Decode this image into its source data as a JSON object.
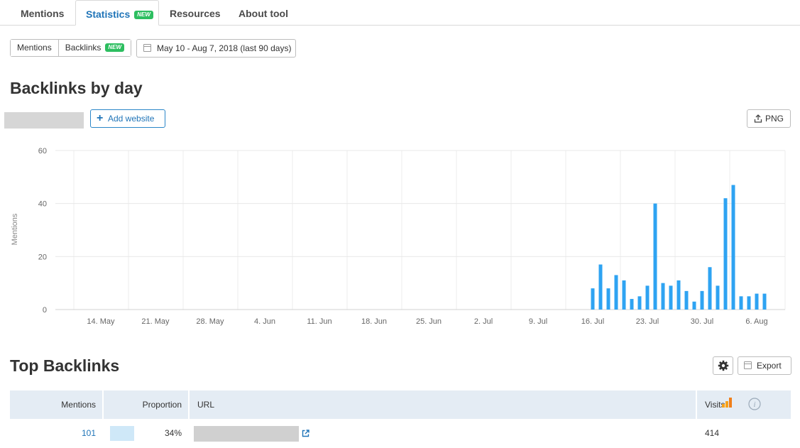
{
  "tabs": [
    {
      "label": "Mentions",
      "active": false
    },
    {
      "label": "Statistics",
      "active": true,
      "badge": "NEW"
    },
    {
      "label": "Resources",
      "active": false
    },
    {
      "label": "About tool",
      "active": false
    }
  ],
  "filters": {
    "segment": [
      {
        "label": "Mentions"
      },
      {
        "label": "Backlinks",
        "badge": "NEW"
      }
    ],
    "date_range": "May 10 - Aug 7, 2018 (last 90 days)"
  },
  "backlinks_section": {
    "title": "Backlinks by day",
    "add_website_label": "Add website",
    "png_label": "PNG"
  },
  "chart_data": {
    "type": "bar",
    "title": "",
    "xlabel": "",
    "ylabel": "Mentions",
    "ylim": [
      0,
      60
    ],
    "yticks": [
      0,
      20,
      40,
      60
    ],
    "grid": true,
    "start_date": "2018-05-10",
    "x_tick_labels": [
      {
        "date": "2018-05-14",
        "label": "14. May"
      },
      {
        "date": "2018-05-21",
        "label": "21. May"
      },
      {
        "date": "2018-05-28",
        "label": "28. May"
      },
      {
        "date": "2018-06-04",
        "label": "4. Jun"
      },
      {
        "date": "2018-06-11",
        "label": "11. Jun"
      },
      {
        "date": "2018-06-18",
        "label": "18. Jun"
      },
      {
        "date": "2018-06-25",
        "label": "25. Jun"
      },
      {
        "date": "2018-07-02",
        "label": "2. Jul"
      },
      {
        "date": "2018-07-09",
        "label": "9. Jul"
      },
      {
        "date": "2018-07-16",
        "label": "16. Jul"
      },
      {
        "date": "2018-07-23",
        "label": "23. Jul"
      },
      {
        "date": "2018-07-30",
        "label": "30. Jul"
      },
      {
        "date": "2018-08-06",
        "label": "6. Aug"
      }
    ],
    "bars": [
      {
        "date": "2018-07-16",
        "value": 8
      },
      {
        "date": "2018-07-17",
        "value": 17
      },
      {
        "date": "2018-07-18",
        "value": 8
      },
      {
        "date": "2018-07-19",
        "value": 13
      },
      {
        "date": "2018-07-20",
        "value": 11
      },
      {
        "date": "2018-07-21",
        "value": 4
      },
      {
        "date": "2018-07-22",
        "value": 5
      },
      {
        "date": "2018-07-23",
        "value": 9
      },
      {
        "date": "2018-07-24",
        "value": 40
      },
      {
        "date": "2018-07-25",
        "value": 10
      },
      {
        "date": "2018-07-26",
        "value": 9
      },
      {
        "date": "2018-07-27",
        "value": 11
      },
      {
        "date": "2018-07-28",
        "value": 7
      },
      {
        "date": "2018-07-29",
        "value": 3
      },
      {
        "date": "2018-07-30",
        "value": 7
      },
      {
        "date": "2018-07-31",
        "value": 16
      },
      {
        "date": "2018-08-01",
        "value": 9
      },
      {
        "date": "2018-08-02",
        "value": 42
      },
      {
        "date": "2018-08-03",
        "value": 47
      },
      {
        "date": "2018-08-04",
        "value": 5
      },
      {
        "date": "2018-08-05",
        "value": 5
      },
      {
        "date": "2018-08-06",
        "value": 6
      },
      {
        "date": "2018-08-07",
        "value": 6
      }
    ],
    "color": "#2ea3f2"
  },
  "top_backlinks": {
    "title": "Top Backlinks",
    "export_label": "Export",
    "columns": {
      "mentions": "Mentions",
      "proportion": "Proportion",
      "url": "URL",
      "visits": "Visits"
    },
    "rows": [
      {
        "mentions": "101",
        "proportion": "34%",
        "proportion_value": 0.34,
        "visits": "414"
      }
    ]
  },
  "colors": {
    "accent": "#1f74b8",
    "badge_green": "#2dbe60",
    "bar_blue": "#2ea3f2",
    "header_bg": "#e4ecf4"
  }
}
